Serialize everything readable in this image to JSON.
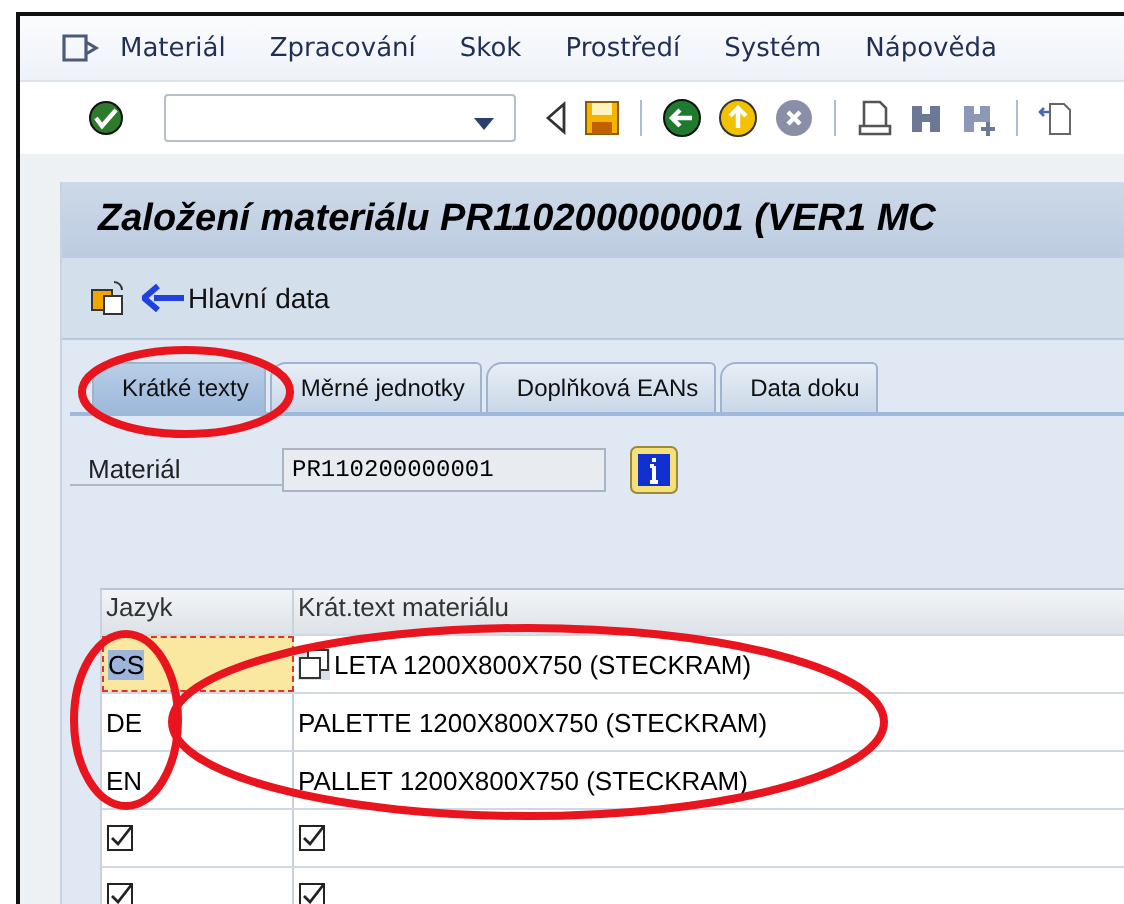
{
  "menu": [
    {
      "label": "Materiál"
    },
    {
      "label": "Zpracování"
    },
    {
      "label": "Skok"
    },
    {
      "label": "Prostředí"
    },
    {
      "label": "Systém"
    },
    {
      "label": "Nápověda"
    }
  ],
  "title": "Založení materiálu PR110200000001 (VER1 MC",
  "app_toolbar": {
    "button": "Hlavní data"
  },
  "tabs": [
    {
      "label": "Krátké texty",
      "selected": true
    },
    {
      "label": "Měrné jednotky",
      "selected": false
    },
    {
      "label": "Doplňková EANs",
      "selected": false
    },
    {
      "label": "Data doku",
      "selected": false
    }
  ],
  "material": {
    "label": "Materiál",
    "value": "PR110200000001"
  },
  "table": {
    "columns": [
      "Jazyk",
      "Krát.text materiálu"
    ],
    "rows": [
      {
        "kind": "text",
        "cells": [
          "CS",
          "LETA 1200X800X750 (STECKRAM)"
        ],
        "selected": true
      },
      {
        "kind": "text",
        "cells": [
          "DE",
          "PALETTE 1200X800X750 (STECKRAM)"
        ],
        "selected": false
      },
      {
        "kind": "text",
        "cells": [
          "EN",
          "PALLET 1200X800X750 (STECKRAM)"
        ],
        "selected": false
      },
      {
        "kind": "empty"
      },
      {
        "kind": "empty"
      }
    ]
  }
}
